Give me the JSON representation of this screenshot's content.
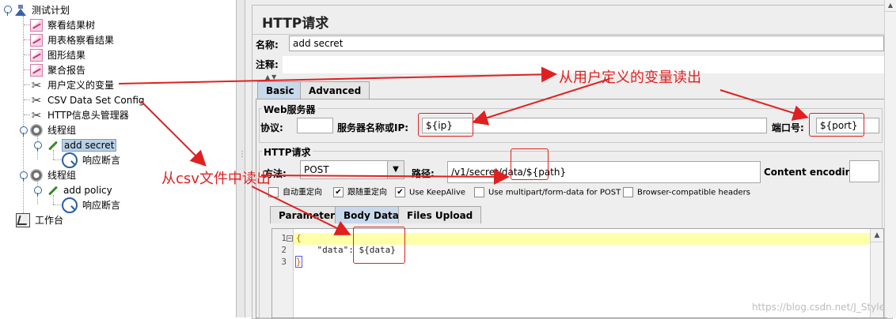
{
  "tree": {
    "root": "测试计划",
    "items": [
      {
        "label": "察看结果树",
        "icon": "chart-icon"
      },
      {
        "label": "用表格察看结果",
        "icon": "chart-icon"
      },
      {
        "label": "图形结果",
        "icon": "chart-icon"
      },
      {
        "label": "聚合报告",
        "icon": "chart-icon"
      },
      {
        "label": "用户定义的变量",
        "icon": "wrench-icon"
      },
      {
        "label": "CSV Data Set Config",
        "icon": "wrench-icon"
      },
      {
        "label": "HTTP信息头管理器",
        "icon": "wrench-icon"
      }
    ],
    "thread_group_1": "线程组",
    "sampler_1": "add secret",
    "assertion_1": "响应断言",
    "thread_group_2": "线程组",
    "sampler_2": "add policy",
    "assertion_2": "响应断言",
    "workbench": "工作台"
  },
  "panel": {
    "title": "HTTP请求",
    "name_label": "名称:",
    "name_value": "add secret",
    "comment_label": "注释:",
    "tabs": [
      "Basic",
      "Advanced"
    ],
    "web_server": {
      "group_title": "Web服务器",
      "protocol_label": "协议:",
      "protocol_value": "",
      "server_label": "服务器名称或IP:",
      "server_value": "${ip}",
      "port_label": "端口号:",
      "port_value": "${port}"
    },
    "http_request": {
      "group_title": "HTTP请求",
      "method_label": "方法:",
      "method_value": "POST",
      "path_label": "路径:",
      "path_value": "/v1/secret/data/${path}",
      "encoding_label": "Content encoding:",
      "encoding_value": ""
    },
    "checkboxes": [
      {
        "label": "自动重定向",
        "checked": false
      },
      {
        "label": "跟随重定向",
        "checked": true
      },
      {
        "label": "Use KeepAlive",
        "checked": true
      },
      {
        "label": "Use multipart/form-data for POST",
        "checked": false
      },
      {
        "label": "Browser-compatible headers",
        "checked": false
      }
    ],
    "subtabs": [
      "Parameters",
      "Body Data",
      "Files Upload"
    ],
    "body_lines": [
      "{",
      "    \"data\": ${data}",
      "}"
    ],
    "line_numbers": [
      "1",
      "2",
      "3"
    ]
  },
  "annotations": {
    "user_vars": "从用户定义的变量读出",
    "csv": "从csv文件中读出",
    "color": "#e02020"
  },
  "watermark": "https://blog.csdn.net/J_Style"
}
